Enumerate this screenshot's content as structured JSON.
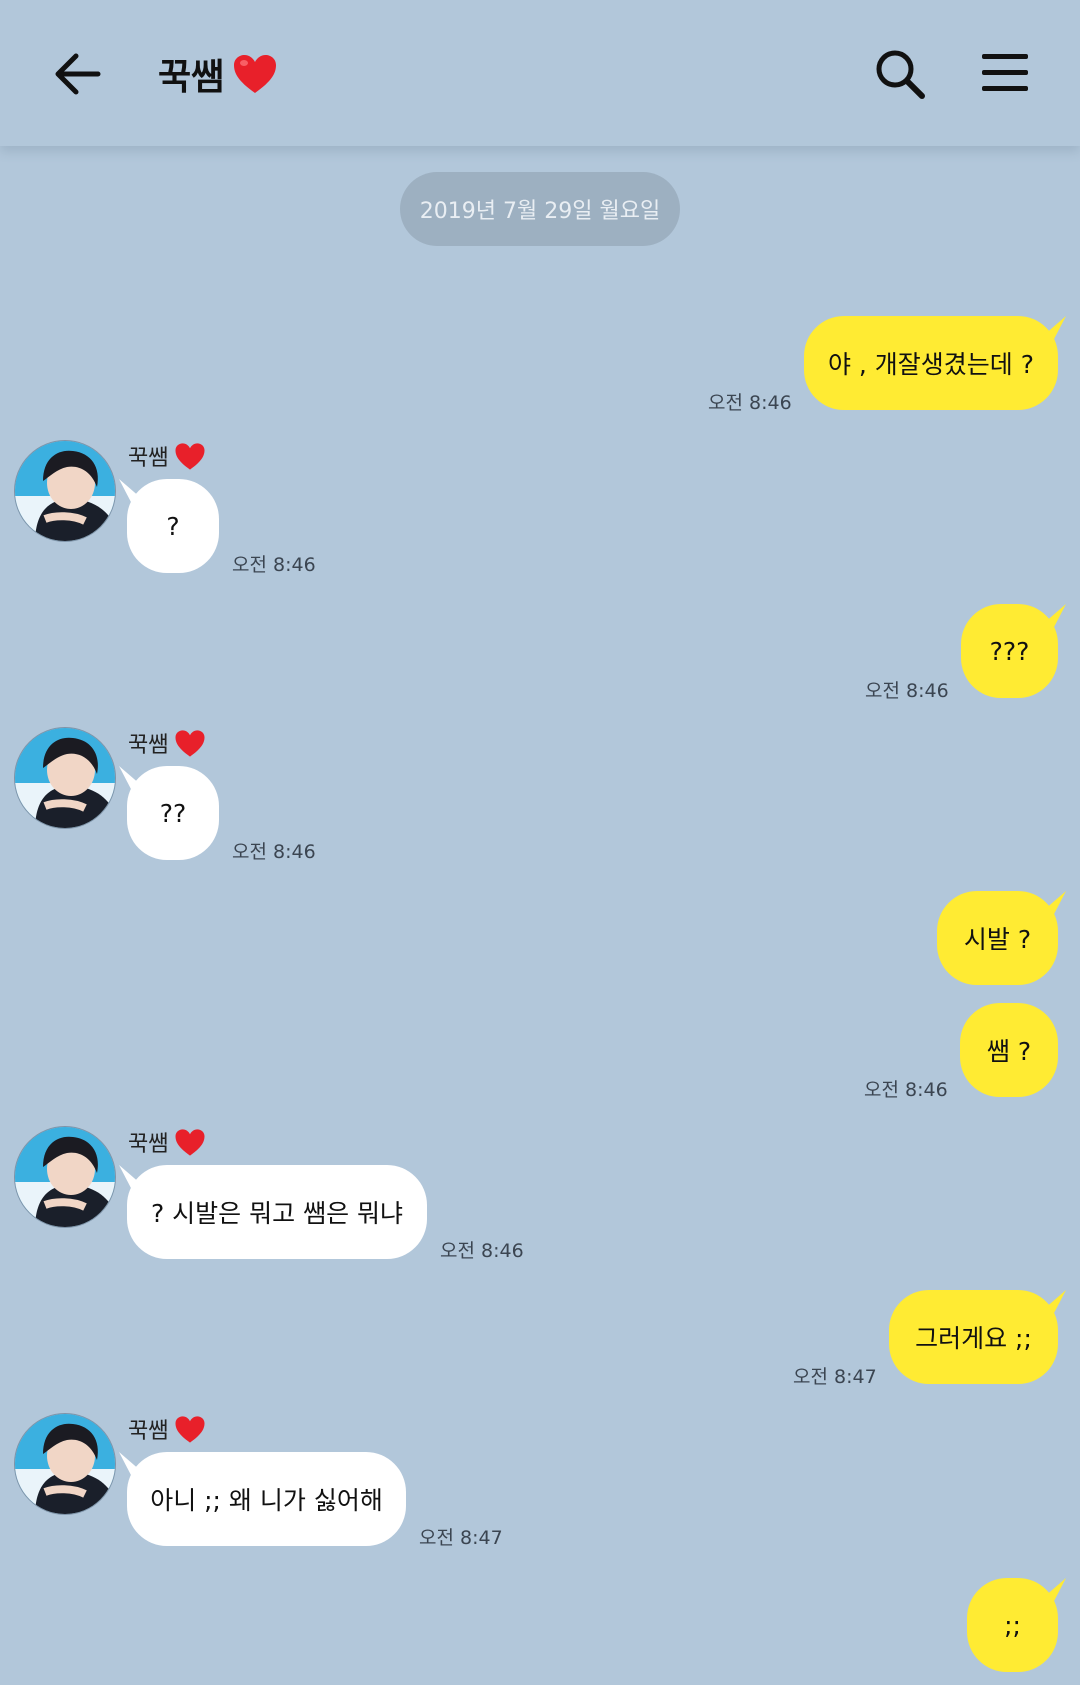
{
  "header": {
    "title": "꾹쌤",
    "title_emoji": "❤️",
    "back_icon": "arrow-left-icon",
    "search_icon": "search-icon",
    "menu_icon": "hamburger-menu-icon"
  },
  "date_divider": "2019년 7월 29일 월요일",
  "contact": {
    "name": "꾹쌤",
    "emoji": "❤️"
  },
  "messages": [
    {
      "from": "me",
      "text": "야 , 개잘생겼는데 ?",
      "time": "오전 8:46"
    },
    {
      "from": "them",
      "text": "?",
      "time": "오전 8:46"
    },
    {
      "from": "me",
      "text": "???",
      "time": "오전 8:46"
    },
    {
      "from": "them",
      "text": "??",
      "time": "오전 8:46"
    },
    {
      "from": "me",
      "text": "시발 ?",
      "time": ""
    },
    {
      "from": "me",
      "text": "쌤 ?",
      "time": "오전 8:46"
    },
    {
      "from": "them",
      "text": "? 시발은 뭐고 쌤은 뭐냐",
      "time": "오전 8:46"
    },
    {
      "from": "me",
      "text": "그러게요 ;;",
      "time": "오전 8:47"
    },
    {
      "from": "them",
      "text": "아니 ;; 왜 니가 싫어해",
      "time": "오전 8:47"
    },
    {
      "from": "me",
      "text": ";;",
      "time": ""
    }
  ],
  "colors": {
    "background": "#b2c7da",
    "my_bubble": "#ffeb33",
    "their_bubble": "#ffffff",
    "date_pill": "#9db0c1"
  }
}
